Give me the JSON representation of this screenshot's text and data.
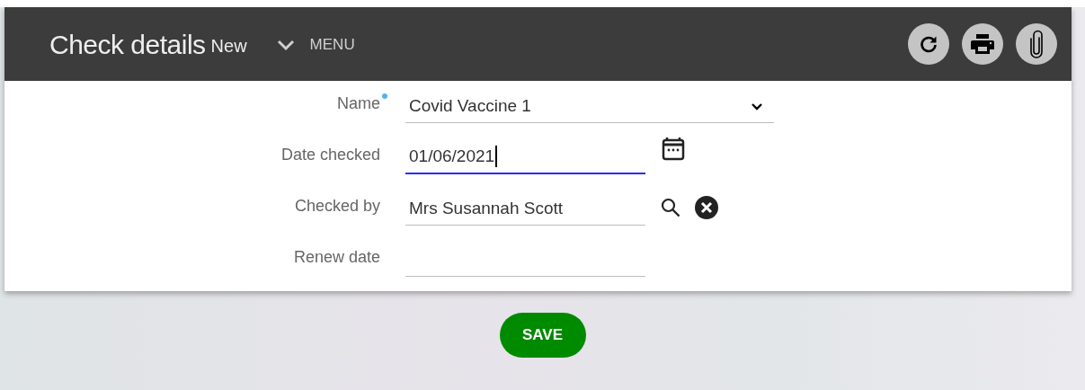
{
  "header": {
    "title": "Check details",
    "badge": "New",
    "menu_label": "MENU",
    "actions": [
      {
        "kind": "refresh"
      },
      {
        "kind": "print"
      },
      {
        "kind": "attach"
      }
    ]
  },
  "fields": [
    {
      "label": "Name",
      "kind": "select",
      "required": true,
      "focused": false,
      "value": "Covid Vaccine 1"
    },
    {
      "label": "Date checked",
      "kind": "date",
      "required": false,
      "focused": true,
      "value": "01/06/2021"
    },
    {
      "label": "Checked by",
      "kind": "lookup",
      "required": false,
      "focused": false,
      "value": "Mrs Susannah Scott"
    },
    {
      "label": "Renew date",
      "kind": "text",
      "required": false,
      "focused": false
    }
  ],
  "save_button": "SAVE"
}
